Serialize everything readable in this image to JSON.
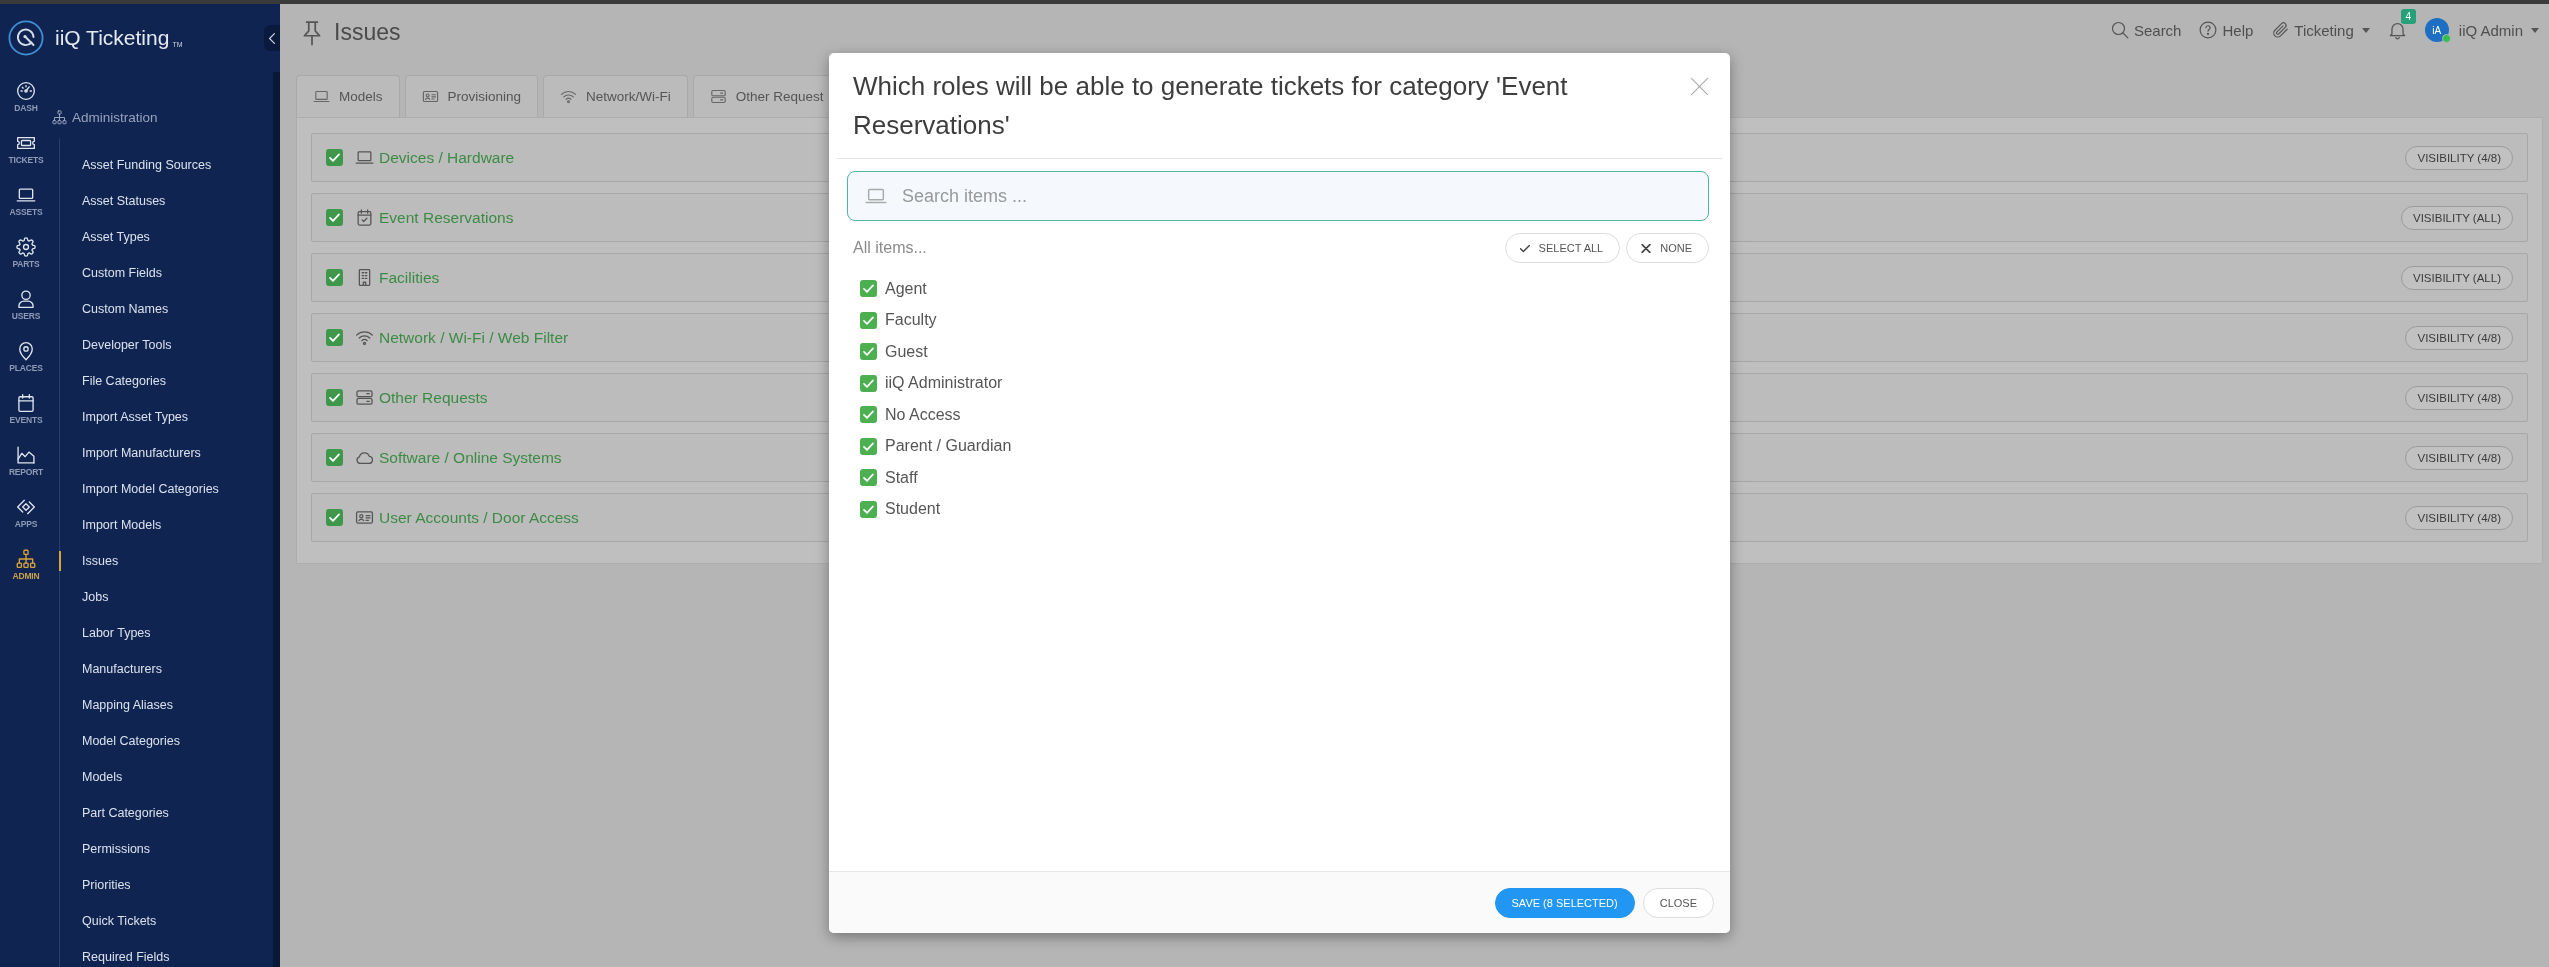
{
  "sidebar": {
    "brand": {
      "name": "iiQ Ticketing",
      "mark": "TM"
    },
    "rail": [
      {
        "label": "DASH",
        "selected": false
      },
      {
        "label": "TICKETS",
        "selected": false
      },
      {
        "label": "ASSETS",
        "selected": false
      },
      {
        "label": "PARTS",
        "selected": false
      },
      {
        "label": "USERS",
        "selected": false
      },
      {
        "label": "PLACES",
        "selected": false
      },
      {
        "label": "EVENTS",
        "selected": false
      },
      {
        "label": "REPORT",
        "selected": false
      },
      {
        "label": "APPS",
        "selected": false
      },
      {
        "label": "ADMIN",
        "selected": true
      }
    ],
    "section": "Administration",
    "menu": [
      {
        "label": "Asset Funding Sources",
        "selected": false
      },
      {
        "label": "Asset Statuses",
        "selected": false
      },
      {
        "label": "Asset Types",
        "selected": false
      },
      {
        "label": "Custom Fields",
        "selected": false
      },
      {
        "label": "Custom Names",
        "selected": false
      },
      {
        "label": "Developer Tools",
        "selected": false
      },
      {
        "label": "File Categories",
        "selected": false
      },
      {
        "label": "Import Asset Types",
        "selected": false
      },
      {
        "label": "Import Manufacturers",
        "selected": false
      },
      {
        "label": "Import Model Categories",
        "selected": false
      },
      {
        "label": "Import Models",
        "selected": false
      },
      {
        "label": "Issues",
        "selected": true
      },
      {
        "label": "Jobs",
        "selected": false
      },
      {
        "label": "Labor Types",
        "selected": false
      },
      {
        "label": "Manufacturers",
        "selected": false
      },
      {
        "label": "Mapping Aliases",
        "selected": false
      },
      {
        "label": "Model Categories",
        "selected": false
      },
      {
        "label": "Models",
        "selected": false
      },
      {
        "label": "Part Categories",
        "selected": false
      },
      {
        "label": "Permissions",
        "selected": false
      },
      {
        "label": "Priorities",
        "selected": false
      },
      {
        "label": "Quick Tickets",
        "selected": false
      },
      {
        "label": "Required Fields",
        "selected": false
      }
    ]
  },
  "header": {
    "title": "Issues",
    "search": "Search",
    "help": "Help",
    "workspace": "Ticketing",
    "notifications": "4",
    "user": {
      "initials": "iA",
      "name": "iiQ Admin",
      "online": true
    }
  },
  "tabs": [
    {
      "label": "Models",
      "selected": false
    },
    {
      "label": "Provisioning",
      "selected": false
    },
    {
      "label": "Network/Wi-Fi",
      "selected": false
    },
    {
      "label": "Other Request",
      "selected": false
    }
  ],
  "categories": [
    {
      "name": "Devices / Hardware",
      "checked": true,
      "visibility": "VISIBILITY (4/8)"
    },
    {
      "name": "Event Reservations",
      "checked": true,
      "visibility": "VISIBILITY (ALL)"
    },
    {
      "name": "Facilities",
      "checked": true,
      "visibility": "VISIBILITY (ALL)"
    },
    {
      "name": "Network / Wi-Fi / Web Filter",
      "checked": true,
      "visibility": "VISIBILITY (4/8)"
    },
    {
      "name": "Other Requests",
      "checked": true,
      "visibility": "VISIBILITY (4/8)"
    },
    {
      "name": "Software / Online Systems",
      "checked": true,
      "visibility": "VISIBILITY (4/8)"
    },
    {
      "name": "User Accounts / Door Access",
      "checked": true,
      "visibility": "VISIBILITY (4/8)"
    }
  ],
  "dialog": {
    "title": "Which roles will be able to generate tickets for category 'Event Reservations'",
    "search": {
      "placeholder": "Search items ..."
    },
    "caption": "All items...",
    "select_all": "SELECT ALL",
    "select_none": "NONE",
    "roles": [
      {
        "label": "Agent",
        "checked": true
      },
      {
        "label": "Faculty",
        "checked": true
      },
      {
        "label": "Guest",
        "checked": true
      },
      {
        "label": "iiQ Administrator",
        "checked": true
      },
      {
        "label": "No Access",
        "checked": true
      },
      {
        "label": "Parent / Guardian",
        "checked": true
      },
      {
        "label": "Staff",
        "checked": true
      },
      {
        "label": "Student",
        "checked": true
      }
    ],
    "buttons": [
      {
        "kind": "primary",
        "label": "SAVE (8 SELECTED)"
      },
      {
        "kind": "default",
        "label": "CLOSE"
      }
    ]
  }
}
